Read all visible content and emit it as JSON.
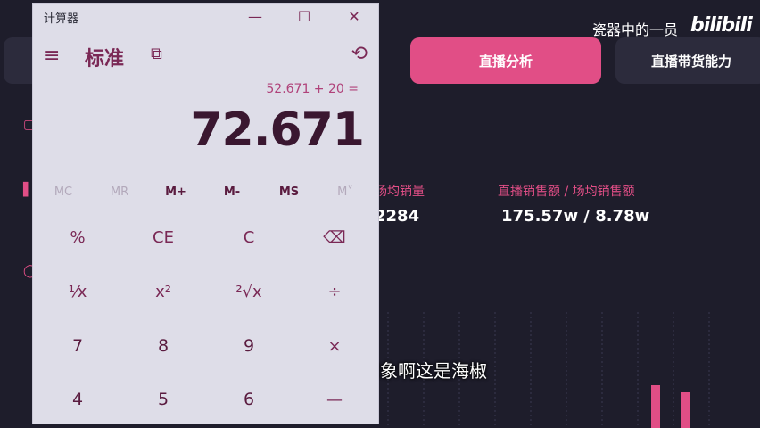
{
  "watermark": {
    "channel": "瓷器中的一员",
    "logo": "bilibili"
  },
  "dashboard": {
    "tabs": [
      "直播分析",
      "直播带货能力"
    ],
    "stats": [
      {
        "label": "场均销量",
        "value": "2284"
      },
      {
        "label": "直播销售额 / 场均销售额",
        "value": "175.57w / 8.78w"
      }
    ]
  },
  "subtitle": "就是认知和想象啊这是海椒",
  "calculator": {
    "title": "计算器",
    "mode": "标准",
    "expression": "52.671 + 20 =",
    "display": "72.671",
    "window_buttons": {
      "minimize": "—",
      "maximize": "☐",
      "close": "✕"
    },
    "memory": [
      "MC",
      "MR",
      "M+",
      "M-",
      "MS",
      "M˅"
    ],
    "keys": [
      [
        "%",
        "CE",
        "C",
        "⌫"
      ],
      [
        "¹⁄x",
        "x²",
        "²√x",
        "÷"
      ],
      [
        "7",
        "8",
        "9",
        "×"
      ],
      [
        "4",
        "5",
        "6",
        "—"
      ]
    ]
  },
  "colors": {
    "accent": "#e14e86",
    "calc_bg": "#dedde8",
    "calc_text": "#7a2855",
    "page_bg": "#1e1d2b"
  }
}
